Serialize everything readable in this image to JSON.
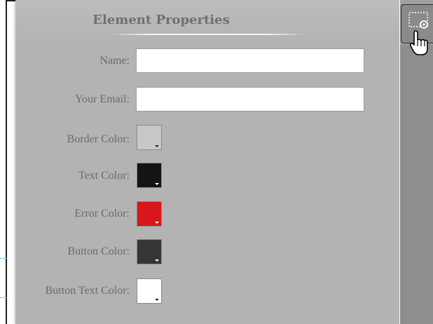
{
  "panel": {
    "title": "Element Properties",
    "fields": [
      {
        "label": "Name:",
        "value": ""
      },
      {
        "label": "Your Email:",
        "value": ""
      }
    ],
    "colors": [
      {
        "label": "Border Color:",
        "color": "#c8c8c8"
      },
      {
        "label": "Text Color:",
        "color": "#141414"
      },
      {
        "label": "Error Color:",
        "color": "#d9161c"
      },
      {
        "label": "Button Color:",
        "color": "#353535"
      },
      {
        "label": "Button Text Color:",
        "color": "#ffffff"
      }
    ]
  },
  "toolbar": {
    "properties_button_icon": "element-properties-icon",
    "cursor_icon": "hand-pointer-icon"
  }
}
